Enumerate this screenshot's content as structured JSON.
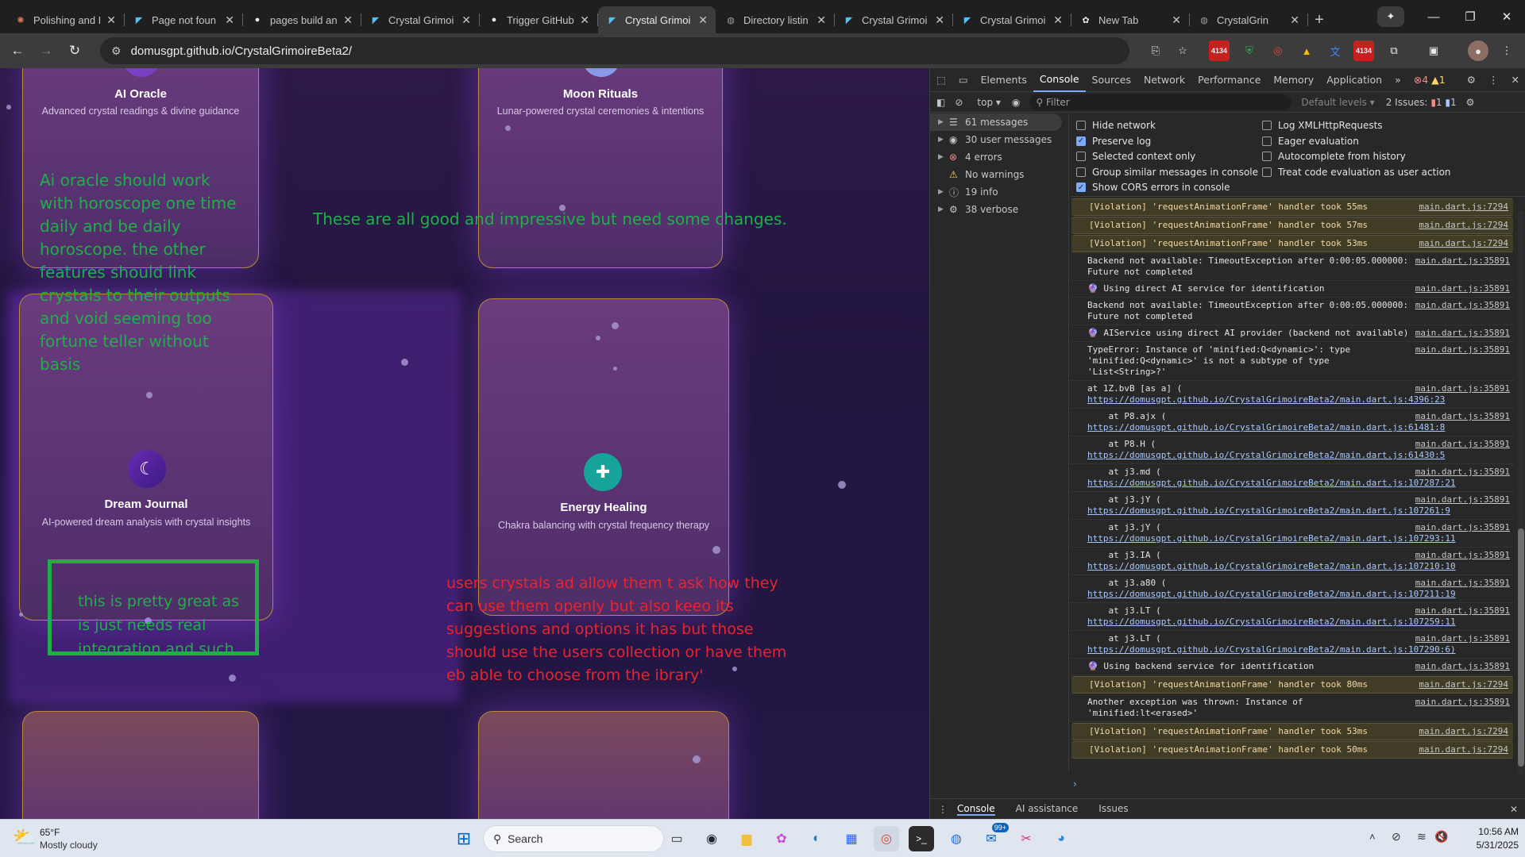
{
  "browser": {
    "tabs": [
      {
        "title": "Polishing and I",
        "icon": "claude-icon",
        "color": "#d97757"
      },
      {
        "title": "Page not foun",
        "icon": "flutter-icon",
        "color": "#4fc3f7"
      },
      {
        "title": "pages build an",
        "icon": "github-icon",
        "color": "#e8eaed"
      },
      {
        "title": "Crystal Grimoi",
        "icon": "flutter-icon",
        "color": "#4fc3f7"
      },
      {
        "title": "Trigger GitHub",
        "icon": "github-icon",
        "color": "#e8eaed"
      },
      {
        "title": "Crystal Grimoi",
        "icon": "flutter-icon",
        "color": "#4fc3f7",
        "active": true
      },
      {
        "title": "Directory listin",
        "icon": "globe-icon",
        "color": "#9aa0a6"
      },
      {
        "title": "Crystal Grimoi",
        "icon": "flutter-icon",
        "color": "#4fc3f7"
      },
      {
        "title": "Crystal Grimoi",
        "icon": "flutter-icon",
        "color": "#4fc3f7"
      },
      {
        "title": "New Tab",
        "icon": "chatgpt-icon",
        "color": "#e8eaed"
      },
      {
        "title": "CrystalGrin",
        "icon": "globe-icon",
        "color": "#9aa0a6"
      }
    ],
    "url": "domusgpt.github.io/CrystalGrimoireBeta2/",
    "badge_count": "4134"
  },
  "page": {
    "cards": {
      "oracle": {
        "title": "AI Oracle",
        "subtitle": "Advanced crystal readings & divine guidance"
      },
      "moon": {
        "title": "Moon Rituals",
        "subtitle": "Lunar-powered crystal ceremonies & intentions"
      },
      "dream": {
        "title": "Dream Journal",
        "subtitle": "AI-powered dream analysis with crystal insights"
      },
      "energy": {
        "title": "Energy Healing",
        "subtitle": "Chakra balancing with crystal frequency therapy"
      }
    },
    "notes": {
      "oracle_note": "Ai oracle should work with horoscope one time daily and be daily horoscope. the other features should link crystals to their outputs and void seeming too fortune teller without basis",
      "general_note": "These are all good and impressive but need some changes.",
      "dream_note": "this is pretty great as is just needs real integration and such",
      "energy_note": "users crystals ad allow them t ask how they can use them openly but also keeo its suggestions and options it has but those should use the users collection or have them eb able to choose from the ibrary'"
    },
    "colors": {
      "green_note": "#1fae4a",
      "red_note": "#e8242e",
      "card_border": "#b88a3a"
    }
  },
  "devtools": {
    "panels": [
      "Elements",
      "Console",
      "Sources",
      "Network",
      "Performance",
      "Memory",
      "Application"
    ],
    "active_panel": "Console",
    "error_count": "4",
    "warning_count": "1",
    "context": "top",
    "filter_placeholder": "Filter",
    "levels": "Default levels",
    "issues": "2 Issues:",
    "issues_err": "1",
    "issues_info": "1",
    "sidebar": [
      {
        "label": "61 messages",
        "icon": "list-icon"
      },
      {
        "label": "30 user messages",
        "icon": "user-icon"
      },
      {
        "label": "4 errors",
        "icon": "error-icon"
      },
      {
        "label": "No warnings",
        "icon": "warning-icon"
      },
      {
        "label": "19 info",
        "icon": "info-icon"
      },
      {
        "label": "38 verbose",
        "icon": "bug-icon"
      }
    ],
    "settings_left": [
      {
        "label": "Hide network",
        "checked": false
      },
      {
        "label": "Preserve log",
        "checked": true
      },
      {
        "label": "Selected context only",
        "checked": false
      },
      {
        "label": "Group similar messages in console",
        "checked": false
      },
      {
        "label": "Show CORS errors in console",
        "checked": true
      }
    ],
    "settings_right": [
      {
        "label": "Log XMLHttpRequests",
        "checked": false
      },
      {
        "label": "Eager evaluation",
        "checked": false
      },
      {
        "label": "Autocomplete from history",
        "checked": false
      },
      {
        "label": "Treat code evaluation as user action",
        "checked": false
      }
    ],
    "log": [
      {
        "type": "warn",
        "text": "[Violation] 'requestAnimationFrame' handler took 55ms",
        "src": "main.dart.js:7294"
      },
      {
        "type": "warn",
        "text": "[Violation] 'requestAnimationFrame' handler took 57ms",
        "src": "main.dart.js:7294"
      },
      {
        "type": "warn",
        "text": "[Violation] 'requestAnimationFrame' handler took 53ms",
        "src": "main.dart.js:7294"
      },
      {
        "type": "log",
        "text": "Backend not available: TimeoutException after 0:00:05.000000: Future not completed",
        "src": "main.dart.js:35891"
      },
      {
        "type": "log",
        "text": "🔮 Using direct AI service for identification",
        "src": "main.dart.js:35891"
      },
      {
        "type": "log",
        "text": "Backend not available: TimeoutException after 0:00:05.000000: Future not completed",
        "src": "main.dart.js:35891"
      },
      {
        "type": "log",
        "text": "🔮 AIService using direct AI provider (backend not available)",
        "src": "main.dart.js:35891"
      },
      {
        "type": "log",
        "text": "TypeError: Instance of 'minified:Q<dynamic>': type 'minified:Q<dynamic>' is not a subtype of type 'List<String>?'",
        "src": "main.dart.js:35891"
      },
      {
        "type": "log",
        "text": "at 1Z.bvB [as a] (",
        "link": "https://domusgpt.github.io/CrystalGrimoireBeta2/main.dart.js:4396:23",
        "src": "main.dart.js:35891"
      },
      {
        "type": "log",
        "text": "    at P8.ajx (",
        "link": "https://domusgpt.github.io/CrystalGrimoireBeta2/main.dart.js:61481:8",
        "src": "main.dart.js:35891"
      },
      {
        "type": "log",
        "text": "    at P8.H (",
        "link": "https://domusgpt.github.io/CrystalGrimoireBeta2/main.dart.js:61430:5",
        "src": "main.dart.js:35891"
      },
      {
        "type": "log",
        "text": "    at j3.md (",
        "link": "https://domusgpt.github.io/CrystalGrimoireBeta2/main.dart.js:107287:21",
        "src": "main.dart.js:35891"
      },
      {
        "type": "log",
        "text": "    at j3.jY (",
        "link": "https://domusgpt.github.io/CrystalGrimoireBeta2/main.dart.js:107261:9",
        "src": "main.dart.js:35891"
      },
      {
        "type": "log",
        "text": "    at j3.jY (",
        "link": "https://domusgpt.github.io/CrystalGrimoireBeta2/main.dart.js:107293:11",
        "src": "main.dart.js:35891"
      },
      {
        "type": "log",
        "text": "    at j3.IA (",
        "link": "https://domusgpt.github.io/CrystalGrimoireBeta2/main.dart.js:107210:10",
        "src": "main.dart.js:35891"
      },
      {
        "type": "log",
        "text": "    at j3.a80 (",
        "link": "https://domusgpt.github.io/CrystalGrimoireBeta2/main.dart.js:107211:19",
        "src": "main.dart.js:35891"
      },
      {
        "type": "log",
        "text": "    at j3.LT (",
        "link": "https://domusgpt.github.io/CrystalGrimoireBeta2/main.dart.js:107259:11",
        "src": "main.dart.js:35891"
      },
      {
        "type": "log",
        "text": "    at j3.LT (",
        "link": "https://domusgpt.github.io/CrystalGrimoireBeta2/main.dart.js:107290:6)",
        "src": "main.dart.js:35891"
      },
      {
        "type": "log",
        "text": "🔮 Using backend service for identification",
        "src": "main.dart.js:35891"
      },
      {
        "type": "warn",
        "text": "[Violation] 'requestAnimationFrame' handler took 80ms",
        "src": "main.dart.js:7294"
      },
      {
        "type": "log",
        "text": "Another exception was thrown: Instance of 'minified:lt<erased>'",
        "src": "main.dart.js:35891"
      },
      {
        "type": "warn",
        "text": "[Violation] 'requestAnimationFrame' handler took 53ms",
        "src": "main.dart.js:7294"
      },
      {
        "type": "warn",
        "text": "[Violation] 'requestAnimationFrame' handler took 50ms",
        "src": "main.dart.js:7294"
      }
    ],
    "drawer_tabs": [
      "Console",
      "AI assistance",
      "Issues"
    ]
  },
  "taskbar": {
    "weather_temp": "65°F",
    "weather_desc": "Mostly cloudy",
    "search_placeholder": "Search",
    "time": "10:56 AM",
    "date": "5/31/2025",
    "mail_badge": "99+"
  }
}
